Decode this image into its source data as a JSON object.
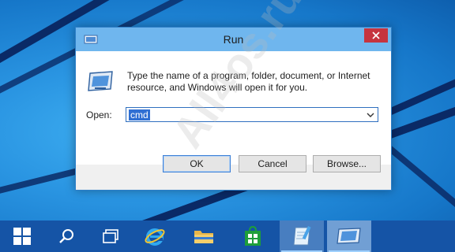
{
  "dialog": {
    "title": "Run",
    "description": "Type the name of a program, folder, document, or Internet resource, and Windows will open it for you.",
    "open_label": "Open:",
    "command_value": "cmd",
    "ok_label": "OK",
    "cancel_label": "Cancel",
    "browse_label": "Browse..."
  },
  "watermark": "All4os.ru",
  "taskbar": {
    "items": [
      {
        "name": "start-button",
        "icon": "windows-logo-icon"
      },
      {
        "name": "search-button",
        "icon": "search-icon"
      },
      {
        "name": "task-view-button",
        "icon": "task-view-icon"
      },
      {
        "name": "internet-explorer",
        "icon": "internet-explorer-icon"
      },
      {
        "name": "file-explorer",
        "icon": "folder-icon"
      },
      {
        "name": "store",
        "icon": "store-icon"
      },
      {
        "name": "notepad",
        "icon": "notepad-icon"
      },
      {
        "name": "run",
        "icon": "run-icon"
      }
    ]
  },
  "colors": {
    "titlebar": "#6fb6ee",
    "close": "#c6343f",
    "selection": "#2f6fd3",
    "taskbar": "#1554a6"
  }
}
